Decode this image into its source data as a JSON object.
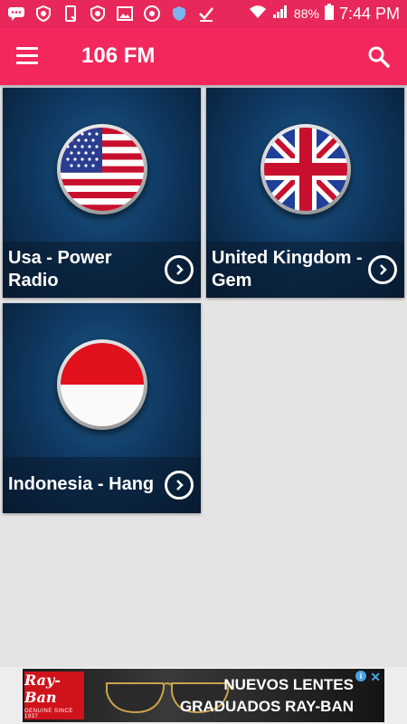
{
  "status_bar": {
    "time": "7:44 PM",
    "battery_percent": "88%",
    "icons": [
      "messaging-icon",
      "shield-icon",
      "phone-icon",
      "shield-icon",
      "image-icon",
      "chrome-icon",
      "shield-badge-icon",
      "check-icon",
      "wifi-icon",
      "signal-icon",
      "battery-icon"
    ]
  },
  "toolbar": {
    "title": "106 FM",
    "menu_icon": "hamburger-menu-icon",
    "search_icon": "search-icon",
    "color": "#f2275b"
  },
  "stations": [
    {
      "label": "Usa - Power Radio",
      "flag": "usa-flag"
    },
    {
      "label": "United Kingdom - Gem",
      "flag": "uk-flag"
    },
    {
      "label": "Indonesia - Hang",
      "flag": "indonesia-flag"
    }
  ],
  "ad": {
    "brand": "Ray-Ban",
    "brand_sub": "GENUINE SINCE 1937",
    "headline_1": "NUEVOS LENTES",
    "headline_2": "GRADUADOS RAY-BAN"
  }
}
